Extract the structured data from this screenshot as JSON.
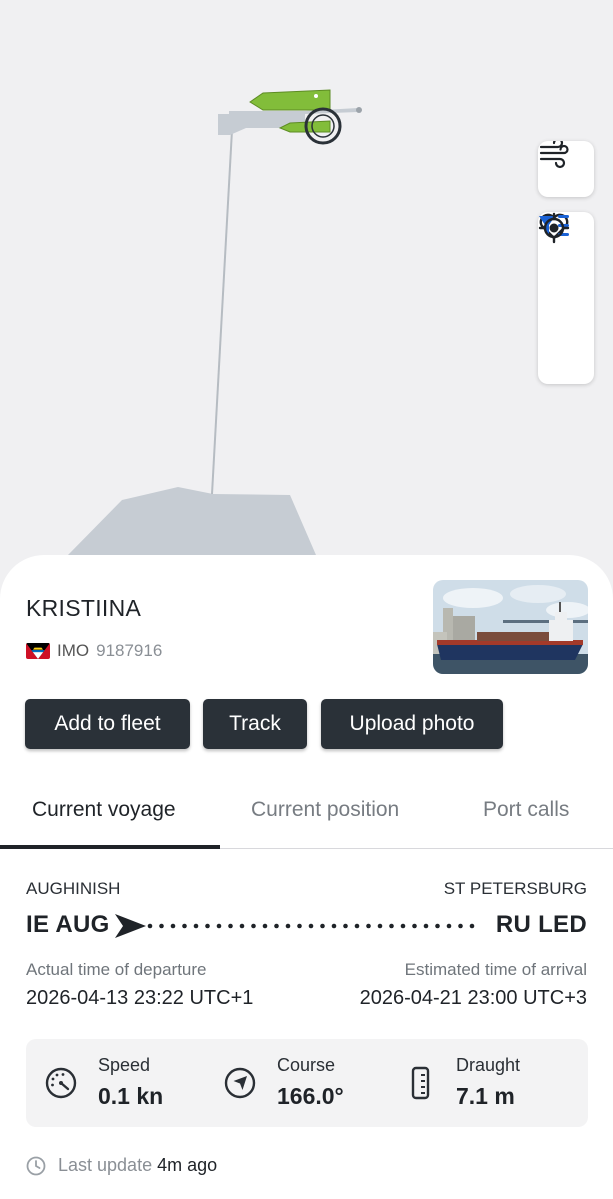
{
  "map": {
    "controls": [
      {
        "icon": "wind-icon"
      },
      {
        "icon": "heart-icon"
      },
      {
        "icon": "filter-list-icon"
      },
      {
        "icon": "locate-target-icon"
      }
    ],
    "colors": {
      "vessel": "#82bd3a",
      "land": "#c6ccd3",
      "background": "#f0f0f2"
    }
  },
  "vessel": {
    "name": "KRISTIINA",
    "flag": "antigua-and-barbuda-flag",
    "imo_label": "IMO",
    "imo_number": "9187916"
  },
  "actions": {
    "add_to_fleet": "Add to fleet",
    "track": "Track",
    "upload_photo": "Upload photo"
  },
  "tabs": [
    {
      "label": "Current voyage",
      "active": true
    },
    {
      "label": "Current position",
      "active": false
    },
    {
      "label": "Port calls",
      "active": false
    }
  ],
  "voyage": {
    "departure": {
      "port_name": "AUGHINISH",
      "code": "IE AUG",
      "time_label": "Actual time of departure",
      "time": "2026-04-13 23:22 UTC+1"
    },
    "arrival": {
      "port_name": "ST PETERSBURG",
      "code": "RU LED",
      "time_label": "Estimated time of arrival",
      "time": "2026-04-21 23:00 UTC+3"
    }
  },
  "stats": {
    "speed": {
      "label": "Speed",
      "value": "0.1 kn",
      "icon": "speedometer-icon"
    },
    "course": {
      "label": "Course",
      "value": "166.0°",
      "icon": "navigation-arrow-icon"
    },
    "draught": {
      "label": "Draught",
      "value": "7.1 m",
      "icon": "ruler-icon"
    }
  },
  "last_update": {
    "label": "Last update",
    "value": "4m ago",
    "icon": "clock-icon"
  }
}
